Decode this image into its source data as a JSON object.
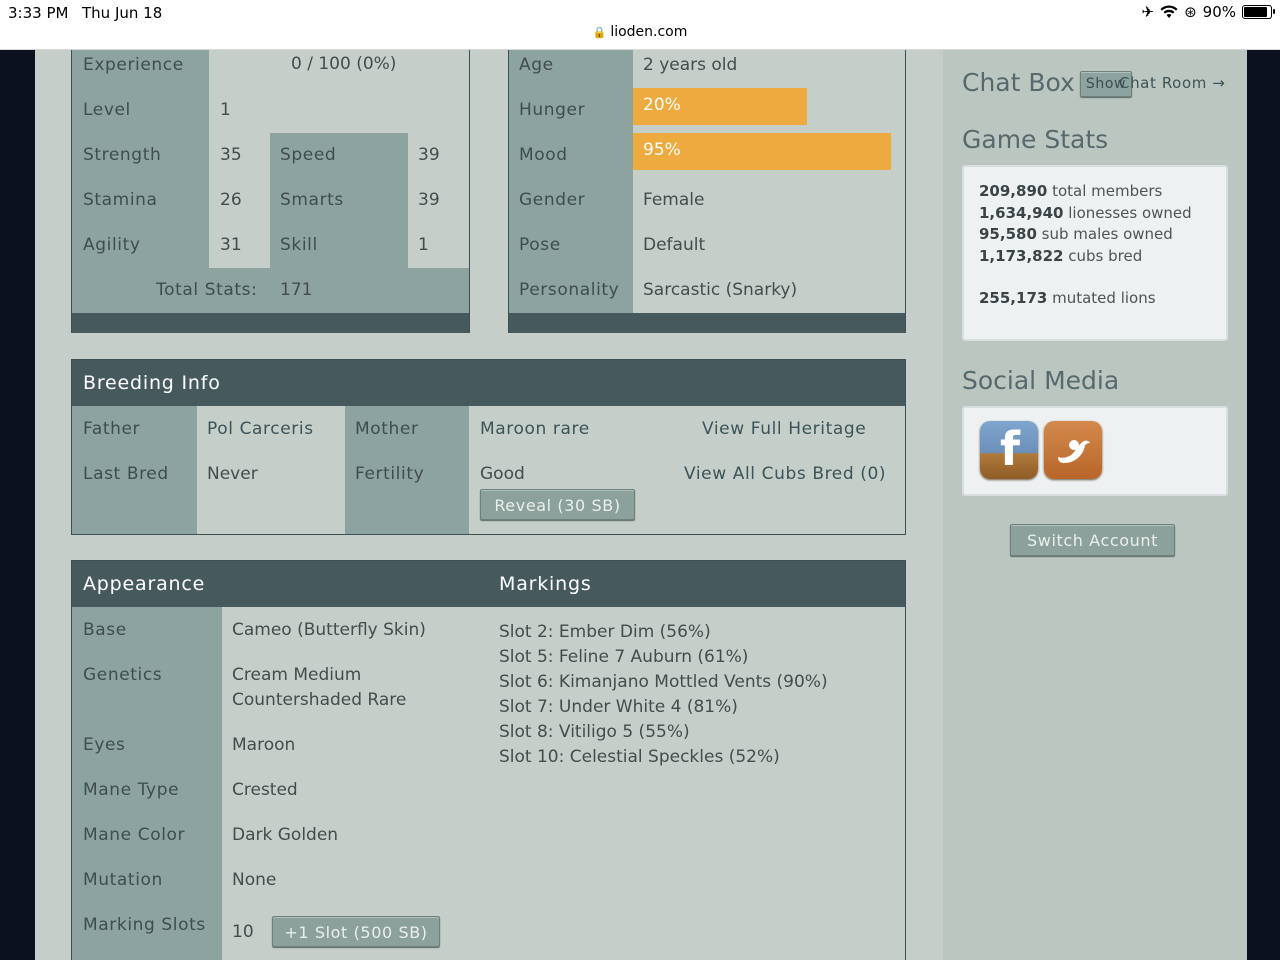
{
  "status_bar": {
    "time": "3:33 PM",
    "date": "Thu Jun 18",
    "url": "lioden.com",
    "battery": "90%",
    "battery_level": 0.9
  },
  "stats_table": {
    "experience": {
      "label": "Experience",
      "value": "0 / 100 (0%)"
    },
    "level": {
      "label": "Level",
      "value": "1"
    },
    "strength": {
      "label": "Strength",
      "value": "35"
    },
    "speed": {
      "label": "Speed",
      "value": "39"
    },
    "stamina": {
      "label": "Stamina",
      "value": "26"
    },
    "smarts": {
      "label": "Smarts",
      "value": "39"
    },
    "agility": {
      "label": "Agility",
      "value": "31"
    },
    "skill": {
      "label": "Skill",
      "value": "1"
    },
    "total": {
      "label": "Total Stats:",
      "value": "171"
    }
  },
  "info_table": {
    "age": {
      "label": "Age",
      "value": "2 years old"
    },
    "hunger": {
      "label": "Hunger",
      "value": "20%",
      "level": 0.2
    },
    "mood": {
      "label": "Mood",
      "value": "95%",
      "level": 0.95
    },
    "gender": {
      "label": "Gender",
      "value": "Female"
    },
    "pose": {
      "label": "Pose",
      "value": "Default"
    },
    "personality": {
      "label": "Personality",
      "value": "Sarcastic (Snarky)"
    }
  },
  "breeding": {
    "title": "Breeding Info",
    "father_label": "Father",
    "father_value": "Pol Carceris",
    "mother_label": "Mother",
    "mother_value": "Maroon rare",
    "heritage_link": "View Full Heritage",
    "last_bred_label": "Last Bred",
    "last_bred_value": "Never",
    "fertility_label": "Fertility",
    "fertility_value": "Good",
    "reveal_button": "Reveal (30 SB)",
    "cubs_link": "View All Cubs Bred (0)"
  },
  "appearance": {
    "title": "Appearance",
    "markings_title": "Markings",
    "rows": {
      "base": {
        "label": "Base",
        "value": "Cameo (Butterfly Skin)"
      },
      "genetics": {
        "label": "Genetics",
        "value_line1": "Cream Medium",
        "value_line2": "Countershaded Rare"
      },
      "eyes": {
        "label": "Eyes",
        "value": "Maroon"
      },
      "mane_type": {
        "label": "Mane Type",
        "value": "Crested"
      },
      "mane_color": {
        "label": "Mane Color",
        "value": "Dark Golden"
      },
      "mutation": {
        "label": "Mutation",
        "value": "None"
      },
      "marking_slots": {
        "label": "Marking Slots",
        "value": "10",
        "button": "+1 Slot (500 SB)"
      }
    },
    "markings": [
      "Slot 2: Ember Dim (56%)",
      "Slot 5: Feline 7 Auburn (61%)",
      "Slot 6: Kimanjano Mottled Vents (90%)",
      "Slot 7: Under White 4 (81%)",
      "Slot 8: Vitiligo 5 (55%)",
      "Slot 10: Celestial Speckles (52%)"
    ]
  },
  "sidebar": {
    "chat_title": "Chat Box",
    "chat_show": "Show",
    "chat_room_link": "Chat Room →",
    "game_stats_title": "Game Stats",
    "game_stats": [
      {
        "num": "209,890",
        "text": "total members"
      },
      {
        "num": "1,634,940",
        "text": "lionesses owned"
      },
      {
        "num": "95,580",
        "text": "sub males owned"
      },
      {
        "num": "1,173,822",
        "text": "cubs bred"
      }
    ],
    "mutated": {
      "num": "255,173",
      "text": "mutated lions"
    },
    "social_title": "Social Media",
    "switch_account": "Switch Account"
  },
  "colors": {
    "header": "#465a5e",
    "label_column": "#8ca39f",
    "page_bg": "#c6ceca",
    "bar": "#ecaa3f"
  }
}
